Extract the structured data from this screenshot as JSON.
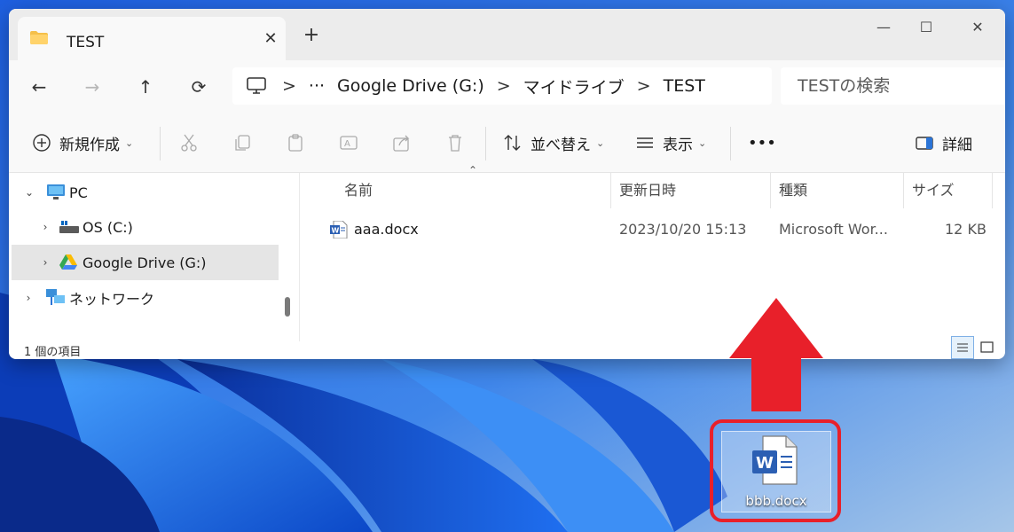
{
  "window": {
    "tab_title": "TEST",
    "tab_close": "✕",
    "new_tab": "+",
    "controls": {
      "minimize": "—",
      "maximize": "☐",
      "close": "✕"
    }
  },
  "address": {
    "back": "←",
    "forward": "→",
    "up": "↑",
    "refresh": "⟳",
    "more": "···",
    "separator": ">",
    "breadcrumbs": [
      "Google Drive (G:)",
      "マイドライブ",
      "TEST"
    ],
    "search_placeholder": "TESTの検索"
  },
  "toolbar": {
    "new_label": "新規作成",
    "sort_label": "並べ替え",
    "view_label": "表示",
    "more_label": "•••",
    "details_label": "詳細"
  },
  "nav_pane": {
    "items": [
      {
        "label": "PC",
        "icon": "pc-icon",
        "expanded": true
      },
      {
        "label": "OS (C:)",
        "icon": "drive-icon",
        "expanded": false
      },
      {
        "label": "Google Drive (G:)",
        "icon": "google-drive-icon",
        "expanded": false,
        "selected": true
      },
      {
        "label": "ネットワーク",
        "icon": "network-icon",
        "expanded": false
      }
    ]
  },
  "file_list": {
    "columns": [
      "名前",
      "更新日時",
      "種類",
      "サイズ"
    ],
    "rows": [
      {
        "name": "aaa.docx",
        "modified": "2023/10/20 15:13",
        "type": "Microsoft Wor...",
        "size": "12 KB"
      }
    ]
  },
  "status": {
    "item_count": "1 個の項目"
  },
  "desktop": {
    "file_label": "bbb.docx"
  },
  "colors": {
    "accent": "#0067c0",
    "highlight_red": "#e8202a",
    "word_blue": "#2b5fb3"
  }
}
